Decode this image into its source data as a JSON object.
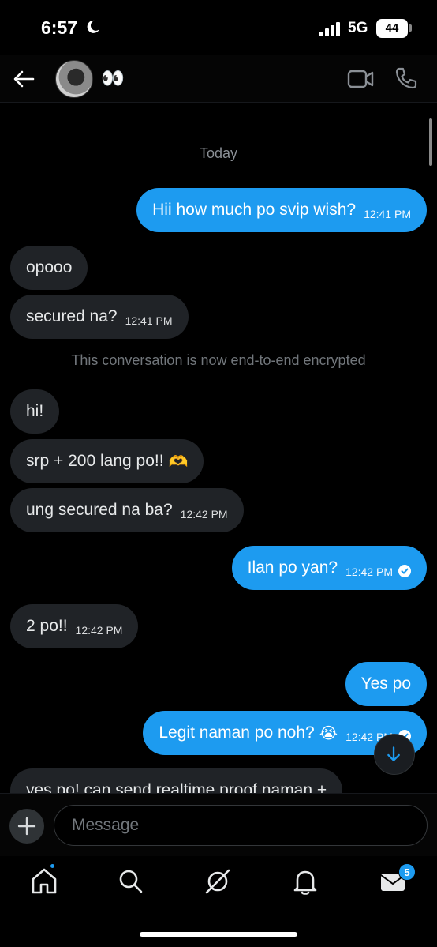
{
  "status": {
    "time": "6:57",
    "network": "5G",
    "battery": "44"
  },
  "header": {
    "contact_name": "👀"
  },
  "conversation": {
    "day_label": "Today",
    "encryption_notice": "This conversation is now end-to-end encrypted",
    "messages": [
      {
        "text": "Hii how much po svip wish?",
        "time": "12:41 PM"
      },
      {
        "text": "opooo"
      },
      {
        "text": "secured na?",
        "time": "12:41 PM"
      },
      {
        "text": "hi!"
      },
      {
        "text": "srp + 200 lang po!!",
        "emoji": "🫶"
      },
      {
        "text": "ung secured na ba?",
        "time": "12:42 PM"
      },
      {
        "text": "Ilan po yan?",
        "time": "12:42 PM"
      },
      {
        "text": "2 po!!",
        "time": "12:42 PM"
      },
      {
        "text": "Yes po"
      },
      {
        "text": "Legit naman po noh?",
        "emoji": "😭",
        "time": "12:42 PM"
      },
      {
        "text": "yes po! can send realtime proof naman +"
      }
    ]
  },
  "composer": {
    "placeholder": "Message"
  },
  "tabbar": {
    "messages_badge": "5"
  },
  "colors": {
    "accent": "#1d9bf0",
    "incoming_bubble": "#202327",
    "background": "#000000"
  }
}
